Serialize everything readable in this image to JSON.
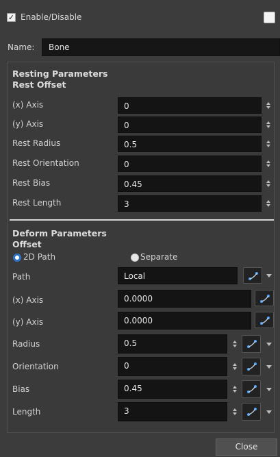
{
  "header": {
    "enable_label": "Enable/Disable",
    "enable_checked": true,
    "color_swatch": "#f4f4f4"
  },
  "name": {
    "label": "Name:",
    "value": "Bone"
  },
  "resting": {
    "title": "Resting Parameters",
    "subtitle": "Rest Offset",
    "fields": [
      {
        "label": "(x) Axis",
        "value": "0"
      },
      {
        "label": "(y) Axis",
        "value": "0"
      },
      {
        "label": "Rest Radius",
        "value": "0.5"
      },
      {
        "label": "Rest Orientation",
        "value": "0"
      },
      {
        "label": "Rest Bias",
        "value": "0.45"
      },
      {
        "label": "Rest Length",
        "value": "3"
      }
    ]
  },
  "deform": {
    "title": "Deform Parameters",
    "subtitle": "Offset",
    "radio_2d_path": "2D Path",
    "radio_separate": "Separate",
    "selected": "2D Path",
    "path": {
      "label": "Path",
      "value": "Local"
    },
    "x_axis": {
      "label": "(x) Axis",
      "value": "0.0000"
    },
    "y_axis": {
      "label": "(y) Axis",
      "value": "0.0000"
    },
    "radius": {
      "label": "Radius",
      "value": "0.5"
    },
    "orientation": {
      "label": "Orientation",
      "value": "0"
    },
    "bias": {
      "label": "Bias",
      "value": "0.45"
    },
    "length": {
      "label": "Length",
      "value": "3"
    }
  },
  "footer": {
    "close_label": "Close"
  },
  "icons": {
    "function": "function-curve-icon",
    "spinner": "spinner-arrows-icon",
    "dropdown": "chevron-down-icon"
  },
  "colors": {
    "background": "#3c3c3c",
    "field": "#141414",
    "accent": "#2f74c8"
  }
}
